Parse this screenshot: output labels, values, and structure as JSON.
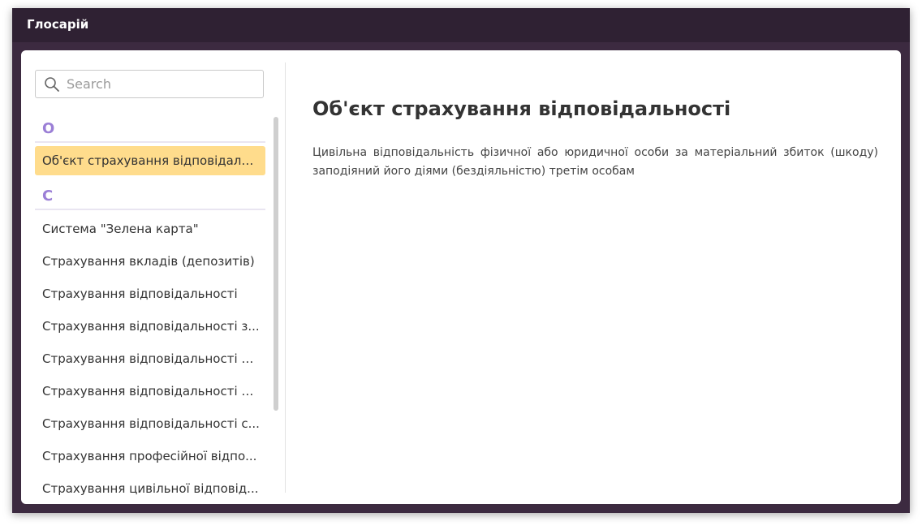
{
  "window": {
    "title": "Глосарій"
  },
  "search": {
    "placeholder": "Search",
    "value": ""
  },
  "glossary": {
    "groups": [
      {
        "letter": "О",
        "items": [
          "Об'єкт страхування відповідальності"
        ]
      },
      {
        "letter": "С",
        "items": [
          "Система \"Зелена карта\"",
          "Страхування вкладів (депозитів)",
          "Страхування відповідальності",
          "Страхування відповідальності з...",
          "Страхування відповідальності п...",
          "Страхування відповідальності п...",
          "Страхування відповідальності с...",
          "Страхування професійної відпо...",
          "Страхування цивільної відповід..."
        ]
      }
    ],
    "selected_item": "Об'єкт страхування відповідальності"
  },
  "detail": {
    "title": "Об'єкт страхування відповідальності",
    "text": "Цивільна відповідальність фізичної або юридичної особи за матеріальний збиток (шкоду) заподіяний його діями (бездіяльністю) третім особам"
  },
  "colors": {
    "titlebar": "#2f2133",
    "window_frame": "#3c2a40",
    "letter_accent": "#9b7fd6",
    "selected_background": "#ffdc8c"
  },
  "icons": {
    "search": "search-icon"
  }
}
